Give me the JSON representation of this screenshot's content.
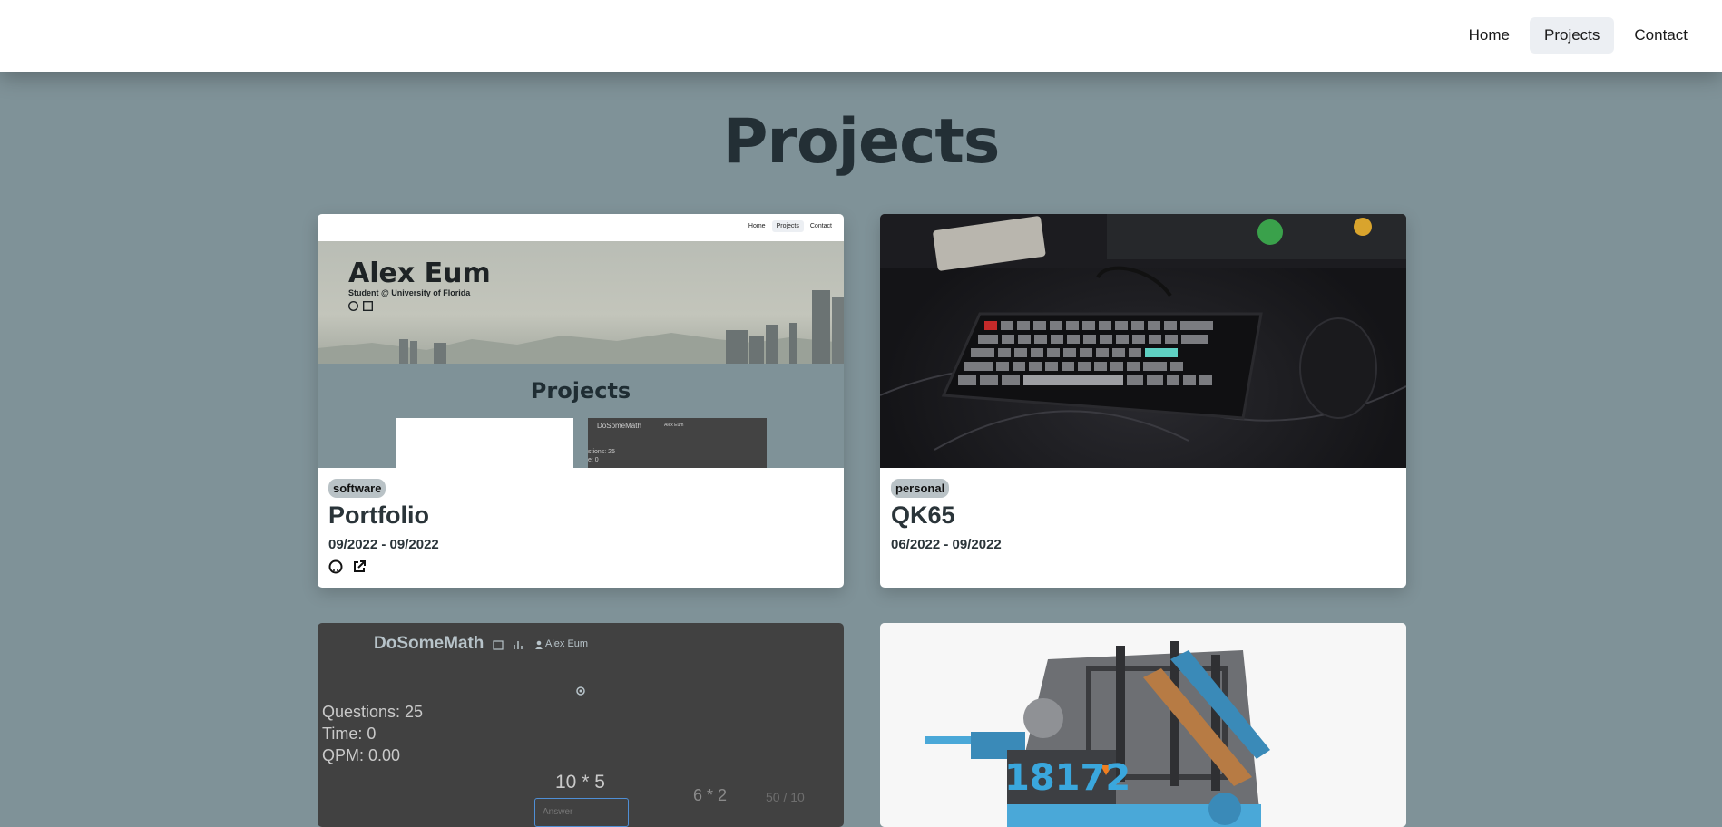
{
  "nav": {
    "items": [
      {
        "label": "Home"
      },
      {
        "label": "Projects"
      },
      {
        "label": "Contact"
      }
    ],
    "active": "Projects"
  },
  "page": {
    "title": "Projects"
  },
  "cards": [
    {
      "badge": "software",
      "title": "Portfolio",
      "date": "09/2022 - 09/2022",
      "icons": [
        "github-icon",
        "external-link-icon"
      ],
      "preview": {
        "nav": [
          "Home",
          "Projects",
          "Contact"
        ],
        "name": "Alex Eum",
        "subtitle": "Student @ University of Florida",
        "section_title": "Projects",
        "card_title": "DoSomeMath",
        "card_user": "Alex Eum",
        "card_text1": "stions: 25",
        "card_text2": "e: 0"
      }
    },
    {
      "badge": "personal",
      "title": "QK65",
      "date": "06/2022 - 09/2022"
    },
    {
      "preview": {
        "app_title": "DoSomeMath",
        "user": "Alex Eum",
        "questions": "Questions: 25",
        "time": "Time: 0",
        "qpm": "QPM: 0.00",
        "current_question": "10 * 5",
        "next_question": "6 * 2",
        "previous_answer": "50 / 10",
        "answer_placeholder": "Answer"
      }
    },
    {
      "preview": {
        "robot_number": "18172"
      }
    }
  ],
  "colors": {
    "page_bg": "#7f9298",
    "nav_bg": "#ffffff",
    "active_nav": "#eceff3",
    "badge_bg": "#b9c2c6"
  }
}
